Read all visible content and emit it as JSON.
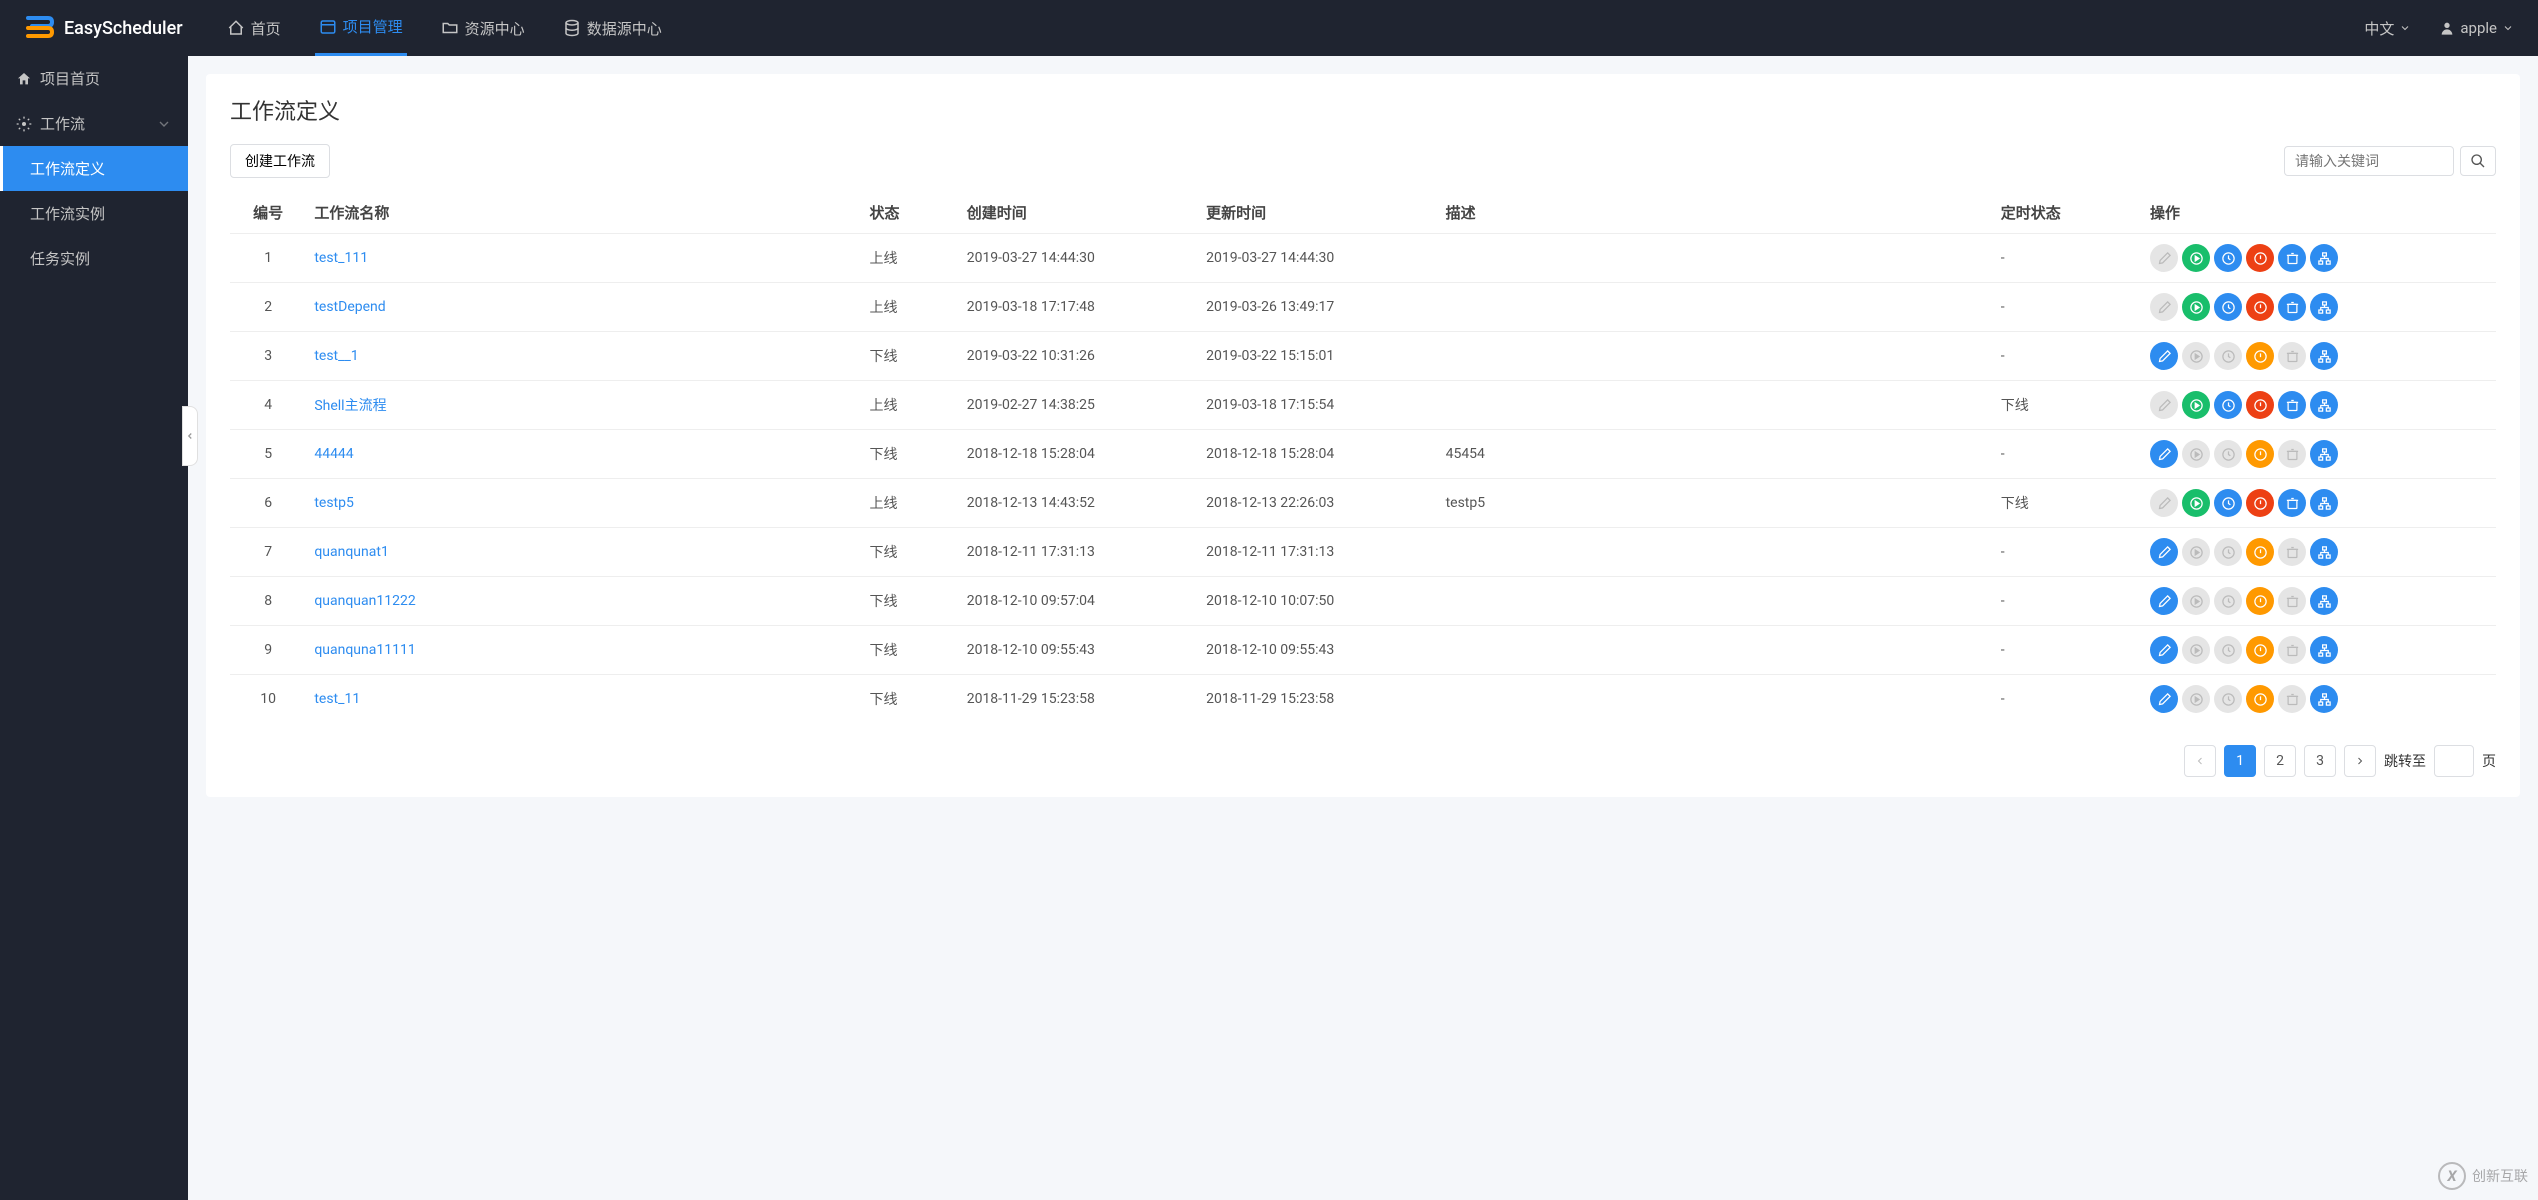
{
  "header": {
    "brand": "EasyScheduler",
    "nav": [
      {
        "label": "首页",
        "icon": "home"
      },
      {
        "label": "项目管理",
        "icon": "project",
        "active": true
      },
      {
        "label": "资源中心",
        "icon": "folder"
      },
      {
        "label": "数据源中心",
        "icon": "database"
      }
    ],
    "language": "中文",
    "user": "apple"
  },
  "sidebar": {
    "items": [
      {
        "label": "项目首页",
        "icon": "home"
      },
      {
        "label": "工作流",
        "icon": "gear",
        "expandable": true
      }
    ],
    "subs": [
      {
        "label": "工作流定义",
        "active": true
      },
      {
        "label": "工作流实例"
      },
      {
        "label": "任务实例"
      }
    ]
  },
  "main": {
    "title": "工作流定义",
    "create_label": "创建工作流",
    "search_placeholder": "请输入关键词",
    "columns": [
      "编号",
      "工作流名称",
      "状态",
      "创建时间",
      "更新时间",
      "描述",
      "定时状态",
      "操作"
    ],
    "rows": [
      {
        "idx": "1",
        "name": "test_111",
        "status": "上线",
        "created": "2019-03-27 14:44:30",
        "updated": "2019-03-27 14:44:30",
        "desc": "",
        "sched": "-"
      },
      {
        "idx": "2",
        "name": "testDepend",
        "status": "上线",
        "created": "2019-03-18 17:17:48",
        "updated": "2019-03-26 13:49:17",
        "desc": "",
        "sched": "-"
      },
      {
        "idx": "3",
        "name": "test__1",
        "status": "下线",
        "created": "2019-03-22 10:31:26",
        "updated": "2019-03-22 15:15:01",
        "desc": "",
        "sched": "-"
      },
      {
        "idx": "4",
        "name": "Shell主流程",
        "status": "上线",
        "created": "2019-02-27 14:38:25",
        "updated": "2019-03-18 17:15:54",
        "desc": "",
        "sched": "下线"
      },
      {
        "idx": "5",
        "name": "44444",
        "status": "下线",
        "created": "2018-12-18 15:28:04",
        "updated": "2018-12-18 15:28:04",
        "desc": "45454",
        "sched": "-"
      },
      {
        "idx": "6",
        "name": "testp5",
        "status": "上线",
        "created": "2018-12-13 14:43:52",
        "updated": "2018-12-13 22:26:03",
        "desc": "testp5",
        "sched": "下线"
      },
      {
        "idx": "7",
        "name": "quanqunat1",
        "status": "下线",
        "created": "2018-12-11 17:31:13",
        "updated": "2018-12-11 17:31:13",
        "desc": "",
        "sched": "-"
      },
      {
        "idx": "8",
        "name": "quanquan11222",
        "status": "下线",
        "created": "2018-12-10 09:57:04",
        "updated": "2018-12-10 10:07:50",
        "desc": "",
        "sched": "-"
      },
      {
        "idx": "9",
        "name": "quanquna11111",
        "status": "下线",
        "created": "2018-12-10 09:55:43",
        "updated": "2018-12-10 09:55:43",
        "desc": "",
        "sched": "-"
      },
      {
        "idx": "10",
        "name": "test_11",
        "status": "下线",
        "created": "2018-11-29 15:23:58",
        "updated": "2018-11-29 15:23:58",
        "desc": "",
        "sched": "-"
      }
    ],
    "pagination": {
      "pages": [
        "1",
        "2",
        "3"
      ],
      "current": "1",
      "jump_label": "跳转至",
      "page_suffix": "页"
    }
  },
  "watermark": "创新互联"
}
